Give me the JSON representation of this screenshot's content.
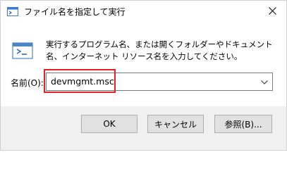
{
  "window": {
    "title": "ファイル名を指定して実行",
    "icon": "run-app-icon",
    "close_icon": "close-icon"
  },
  "content": {
    "description": "実行するプログラム名、または開くフォルダーやドキュメント名、インターネット リソース名を入力してください。",
    "open_label": "名前(O):",
    "open_value": "devmgmt.msc",
    "dropdown_icon": "chevron-down-icon",
    "highlight_color": "#e0212a"
  },
  "buttons": {
    "ok": "OK",
    "cancel": "キャンセル",
    "browse": "参照(B)..."
  }
}
